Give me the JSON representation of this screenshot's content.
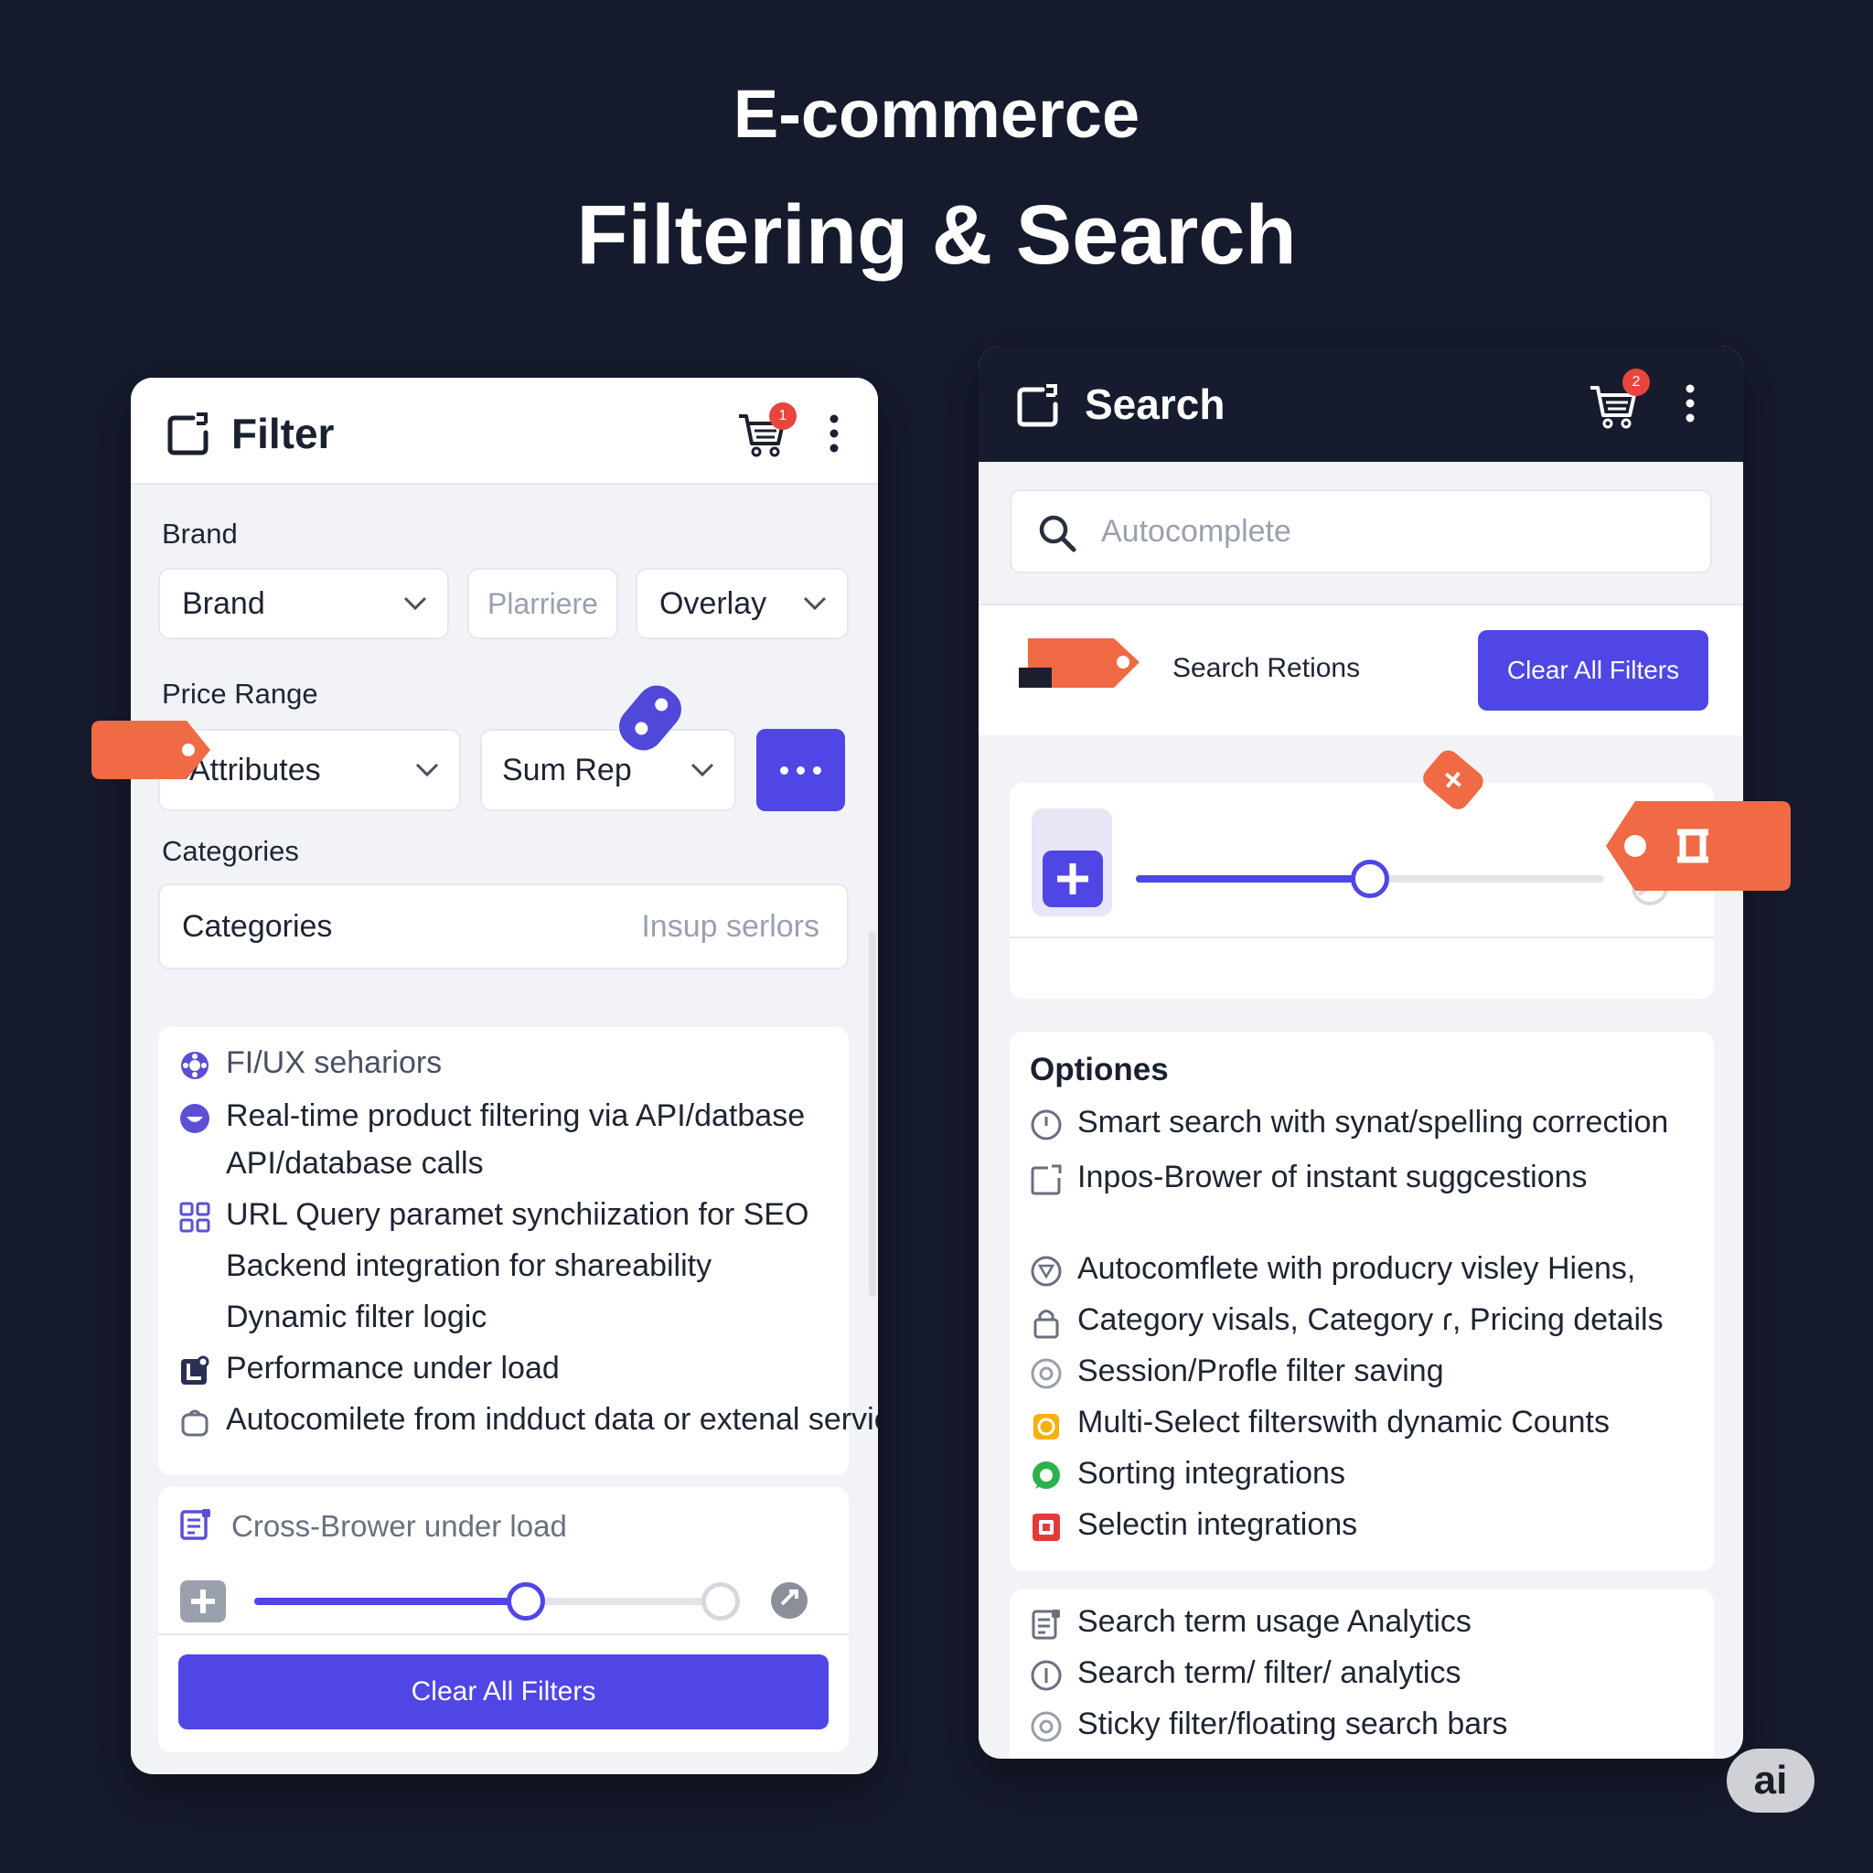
{
  "header": {
    "line1": "E-commerce",
    "line2": "Filtering & Search"
  },
  "filter_panel": {
    "title": "Filter",
    "cart_badge": "1",
    "brand_label": "Brand",
    "brand_select": "Brand",
    "brand_placeholder": "Plarriere",
    "overlay_select": "Overlay",
    "price_label": "Price Range",
    "attributes_select": "Attributes",
    "sum_select": "Sum Rep",
    "categories_label": "Categories",
    "categories_field": "Categories",
    "categories_placeholder": "Insup serlors",
    "features": [
      "FI/UX sehariors",
      "Real-time product filtering via API/datbase",
      "API/database calls",
      "URL Query paramet synchiization for SEO",
      "Backend integration for shareability",
      "Dynamic filter logic",
      "Performance under load",
      "Autocomilete from indduct data or extenal services"
    ],
    "card2_title": "Cross-Brower under load",
    "slider_value": 0.56,
    "clear_button": "Clear All Filters"
  },
  "search_panel": {
    "title": "Search",
    "cart_badge": "2",
    "search_placeholder": "Autocomplete",
    "search_retions": "Search Retions",
    "clear_button": "Clear All Filters",
    "slider_value": 0.5,
    "options_title": "Optiones",
    "options": [
      "Smart search with synat/spelling correction",
      "Inpos-Brower of instant suggcestions",
      "Autocomflete with producry visley Hiens,",
      "Category visals, Category ɾ, Pricing details",
      "Session/Profle filter saving",
      "Multi-Select filterswith dynamic Counts",
      "Sorting integrations",
      "Selectin integrations"
    ],
    "analytics": [
      "Search term usage Analytics",
      "Search term/ filter/ analytics",
      "Sticky filter/floating search bars"
    ]
  },
  "corner_badge": "ai",
  "colors": {
    "accent": "#4f46e5",
    "tag": "#ef6a45",
    "badge": "#e8453c",
    "background": "#151a2c"
  }
}
